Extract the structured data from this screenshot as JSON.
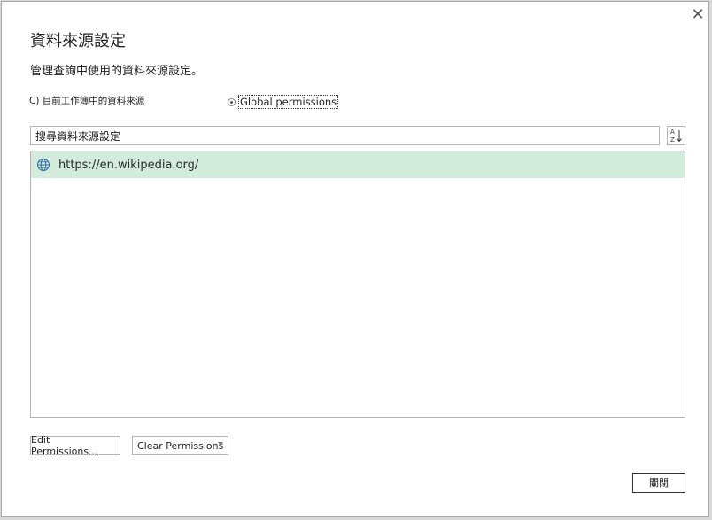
{
  "dialog": {
    "title": "資料來源設定",
    "subtitle": "管理查詢中使用的資料來源設定。",
    "close_glyph": "✕"
  },
  "scope": {
    "current_label": "C) 目前工作簿中的資料來源",
    "global_label": "Global permissions",
    "selected": "global"
  },
  "search": {
    "value": "搜尋資料來源設定",
    "sort_icon": "sort-az-icon"
  },
  "sources": [
    {
      "icon": "globe-icon",
      "url": "https://en.wikipedia.org/",
      "selected": true
    }
  ],
  "buttons": {
    "edit_permissions": "Edit Permissions...",
    "clear_permissions": "Clear Permissions",
    "close": "關閉"
  },
  "colors": {
    "selected_row": "#d2ebdd",
    "globe": "#2e6da4"
  }
}
